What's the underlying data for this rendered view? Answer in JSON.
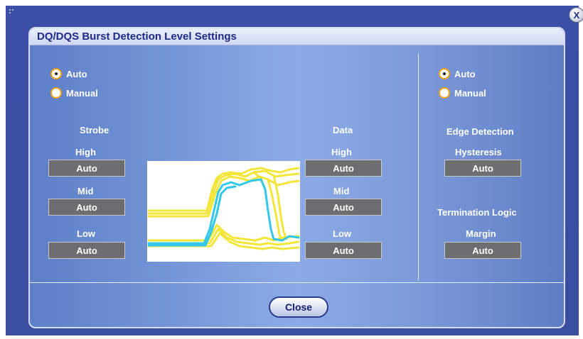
{
  "window": {
    "close_glyph": "X"
  },
  "dialog": {
    "title": "DQ/DQS Burst Detection Level Settings",
    "close_label": "Close"
  },
  "strobe_data": {
    "mode_options": [
      {
        "label": "Auto",
        "checked": true
      },
      {
        "label": "Manual",
        "checked": false
      }
    ],
    "strobe": {
      "title": "Strobe",
      "high_label": "High",
      "high_value": "Auto",
      "mid_label": "Mid",
      "mid_value": "Auto",
      "low_label": "Low",
      "low_value": "Auto"
    },
    "data": {
      "title": "Data",
      "high_label": "High",
      "high_value": "Auto",
      "mid_label": "Mid",
      "mid_value": "Auto",
      "low_label": "Low",
      "low_value": "Auto"
    }
  },
  "edge": {
    "mode_options": [
      {
        "label": "Auto",
        "checked": true
      },
      {
        "label": "Manual",
        "checked": false
      }
    ],
    "edge_title": "Edge Detection",
    "hysteresis_label": "Hysteresis",
    "hysteresis_value": "Auto",
    "termination_title": "Termination Logic",
    "margin_label": "Margin",
    "margin_value": "Auto"
  },
  "colors": {
    "strobe_trace": "#31c8ec",
    "data_trace": "#f2e63a",
    "radio_ring": "#f2a21a"
  },
  "icons": {
    "window_close": "close-icon",
    "waveform": "waveform-preview-image"
  }
}
